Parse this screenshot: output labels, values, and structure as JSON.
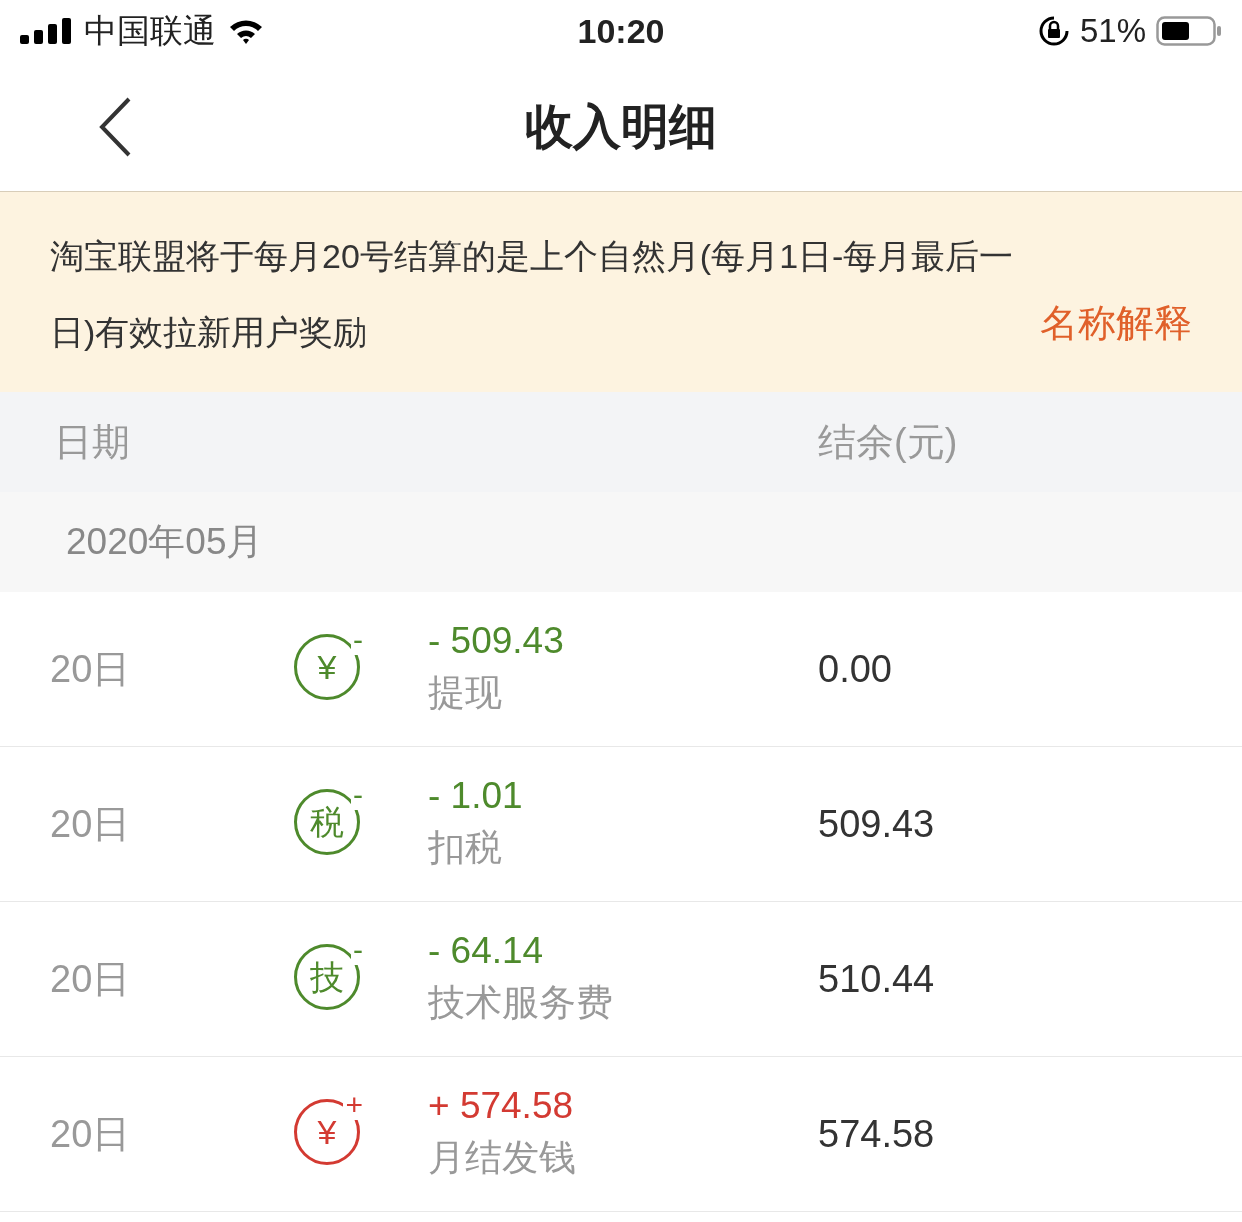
{
  "status_bar": {
    "carrier": "中国联通",
    "time": "10:20",
    "battery": "51%"
  },
  "nav": {
    "title": "收入明细"
  },
  "notice": {
    "text": "淘宝联盟将于每月20号结算的是上个自然月(每月1日-每月最后一日)有效拉新用户奖励",
    "link": "名称解释"
  },
  "table": {
    "columns": [
      "日期",
      "结余(元)"
    ],
    "month": "2020年05月",
    "rows": [
      {
        "date": "20日",
        "kind": "out",
        "icon_text": "¥",
        "sign": "-",
        "amount": "- 509.43",
        "type": "提现",
        "balance": "0.00"
      },
      {
        "date": "20日",
        "kind": "out",
        "icon_text": "税",
        "sign": "-",
        "amount": "- 1.01",
        "type": "扣税",
        "balance": "509.43"
      },
      {
        "date": "20日",
        "kind": "out",
        "icon_text": "技",
        "sign": "-",
        "amount": "- 64.14",
        "type": "技术服务费",
        "balance": "510.44"
      },
      {
        "date": "20日",
        "kind": "in",
        "icon_text": "¥",
        "sign": "+",
        "amount": "+ 574.58",
        "type": "月结发钱",
        "balance": "574.58"
      }
    ]
  }
}
